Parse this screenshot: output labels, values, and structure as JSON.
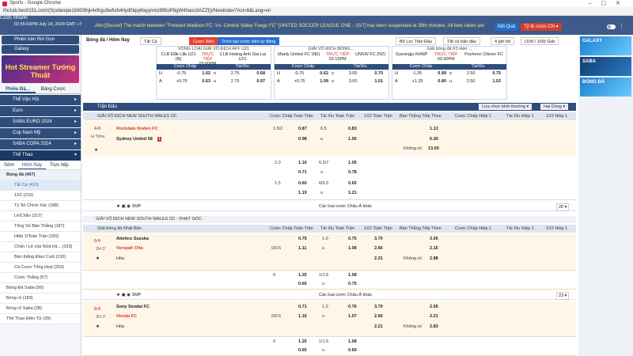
{
  "window": {
    "title": "Sports - Google Chrome",
    "url": "l0v1ob.bes0151.com/(S(odeoipe1b9G9hjk4xfkgu5wfuih4rlyd0tqq4fayynmz995oP6gW4haoo3AZZt))/Newindex?Act=8&Lang=vn"
  },
  "topbar": {
    "time": "02:55:03PM July 14, 2024 GMT +7",
    "marquee": "Attn:[Soccer] The match between \"Forward Madison FC -Vs- Central Valley Fuego FC\" [UNITED SOCCER LEAGUE ONE - 15/7] has been suspended at 39th minutes. All bets taken are",
    "results_btn": "Kết Quả",
    "odds_type_btn": "Tỷ lệ cược CN ▾",
    "quick_bet_label": "Cược Nhanh"
  },
  "left": {
    "lobby_btn": "Phiên bản Rút Gọn",
    "galaxy": "Galaxy",
    "promo": "Hot Streamer Tướng Thuật",
    "tabs": [
      "Phiếu Đặ...",
      "Bảng Cược"
    ],
    "categories": [
      "Thể Vận Hội",
      "Euro",
      "SABA EURO 2024",
      "Cúp Nam Mỹ",
      "SABA COPA 2024"
    ],
    "sports_cat": "Thể Thao",
    "subtabs": [
      "Sớm",
      "Hôm Nay",
      "Trực tiếp"
    ],
    "soccer_head": "Bóng đá (497)",
    "items": [
      "Tất Cả (410)",
      "1X2 (216)",
      "Tỷ Số Chính Xác (188)",
      "Lẻ/Chẵn (217)",
      "Tổng Số Bàn Thắng (187)",
      "Hiệp 1/Toàn Trận (160)",
      "Chấn / Lẻ của Nửa trà... (163)",
      "Bàn thắng Đầu/ Cuối (132)",
      "Cá Cược Tổng Hợp (253)",
      "Cược Thắng (57)"
    ],
    "other": [
      "Bóng Đá Saba (56)",
      "Bóng rổ (183)",
      "Bóng rổ Saba (28)",
      "Thể Thao Điện Tử (39)"
    ]
  },
  "filters": {
    "title": "Bóng đá / Hôm Nay",
    "all": "Tất Cả",
    "bet_btn": "Cược Xiên",
    "create_btn": "Trình tạo cược xiên tự động",
    "league_filter": "Bộ Lọc Trận Đấu",
    "all_matches": "Tất cả trận đấu",
    "hours": "4 giờ tới",
    "count": "(109 / 109) Giải"
  },
  "featured": [
    {
      "league": "VÒNG LOẠI GIẢI VÔ ĐỊCH AFF U21",
      "home": "CLB Đắk Lắk U21 (N)",
      "status": "TRỰC TIẾP",
      "time": "03:00PM",
      "away": "CLB Hoàng Anh Gia Lai U21",
      "h": [
        "H",
        "-0.75",
        "1.02",
        "o",
        "2.75",
        "0.68"
      ],
      "a": [
        "A",
        "+0.75",
        "0.63",
        "u",
        "2.75",
        "0.97"
      ]
    },
    {
      "league": "GIẢI VÔ ĐỊCH BÓNG ...",
      "home": "Manly United FC (N0)",
      "status": "TRỰC TIẾP",
      "time": "03:15PM",
      "away": "UNSW FC (N2)",
      "h": [
        "H",
        "-0.75",
        "0.62",
        "o",
        "3.00",
        "0.70"
      ],
      "a": [
        "A",
        "+0.75",
        "1.09",
        "u",
        "3.00",
        "1.01"
      ]
    },
    {
      "league": "Giải bóng đá K3 Hàn ...",
      "home": "Gyeongju KHNP",
      "status": "TRỰC TIẾP",
      "time": "03:30PM",
      "away": "Pocheon Citizen FC",
      "h": [
        "H",
        "-1.25",
        "0.99",
        "o",
        "2.50",
        "0.75"
      ],
      "a": [
        "A",
        "+1.25",
        "0.80",
        "u",
        "2.50",
        "1.02"
      ]
    }
  ],
  "featured_hdr": [
    "Cược Chấp",
    "Tài/Xỉu"
  ],
  "board": {
    "title": "Trận Đấu",
    "sort": "Lựa chọn bình thường ▾",
    "sort2": "Hai Dòng ▾"
  },
  "cols": [
    "Cược Chấp Toàn Trận",
    "Tài Xỉu Toàn Trận",
    "1X2 Toàn Trận",
    "Bàn Thắng Tiếp Theo",
    "Cược Chấp Hiệp 1",
    "Tài Xỉu Hiệp 1",
    "1X2 Hiệp 1"
  ],
  "league1": "GIẢI VÔ ĐỊCH NEW SOUTH WALES ÚC",
  "match1": {
    "score": "4-0",
    "time": "H.Time",
    "home": "Rockdale Ilinden FC",
    "away": "Sydney United 58",
    "card": "1",
    "rows": [
      [
        "1.5/2",
        "0.87",
        "6.5",
        "0.83",
        "",
        "1.13"
      ],
      [
        "",
        "0.98",
        "u",
        "1.00",
        "",
        "6.30"
      ],
      [
        "",
        "",
        "",
        "",
        "Không có",
        "13.00"
      ]
    ]
  },
  "match1_extra": [
    [
      "2.0",
      "1.16",
      "6.5/7",
      "1.05"
    ],
    [
      "",
      "0.71",
      "u",
      "0.78"
    ],
    [
      "1.5",
      "0.60",
      "6/6.5",
      "0.65"
    ],
    [
      "",
      "1.19",
      "u",
      "1.21"
    ]
  ],
  "more_bets": "Các loại cược Châu Á khác",
  "page_sel": "20 ▾",
  "league2": "GIẢI VÔ ĐỊCH NEW SOUTH WALES ÚC - PHẠT GÓC",
  "league3_title": "Giải bóng đá Nhật Bản",
  "match2": {
    "score": "0-0",
    "time": "2H 3'",
    "home": "Atletico Suzuka",
    "away": "Verspah Oita",
    "draw": "Hòa",
    "rows": [
      [
        "",
        "0.75",
        "1.0",
        "0.75",
        "3.70",
        "",
        "3.05"
      ],
      [
        "0/0.5",
        "1.11",
        "u",
        "1.08",
        "2.66",
        "",
        "2.15"
      ],
      [
        "",
        "",
        "",
        "",
        "2.21",
        "Không có",
        "2.88"
      ]
    ]
  },
  "match2_extra": [
    [
      "0",
      "1.25",
      "1/1.5",
      "1.08"
    ],
    [
      "",
      "0.65",
      "u",
      "0.75"
    ]
  ],
  "page_sel2": "23 ▾",
  "match3": {
    "score": "0-0",
    "time": "2H 3'",
    "home": "Sony Sendai FC",
    "away": "Honda FC",
    "draw": "Hòa",
    "rows": [
      [
        "",
        "0.71",
        "1.0",
        "0.76",
        "3.70",
        "",
        "2.95"
      ],
      [
        "0/0.5",
        "1.16",
        "u",
        "1.07",
        "2.66",
        "",
        "2.21"
      ],
      [
        "",
        "",
        "",
        "",
        "2.21",
        "Không có",
        "2.83"
      ]
    ]
  },
  "match3_extra": [
    [
      "0",
      "1.25",
      "1/1.5",
      "1.08"
    ],
    [
      "",
      "0.65",
      "u",
      "0.69"
    ]
  ],
  "ads": [
    "GALAXY",
    "SABA",
    "BÓNG ĐÁ"
  ]
}
